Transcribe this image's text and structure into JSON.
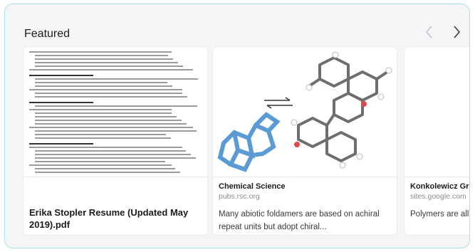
{
  "section": {
    "title": "Featured"
  },
  "nav": {
    "prev_icon": "chevron-left-icon",
    "next_icon": "chevron-right-icon"
  },
  "cards": [
    {
      "title": "Erika Stopler Resume (Updated May 2019).pdf"
    },
    {
      "title": "Chemical Science",
      "source": "pubs.rsc.org",
      "description": "Many abiotic foldamers are based on achiral repeat units but adopt chiral..."
    },
    {
      "title": "Konkolewicz Gro",
      "source": "sites.google.com",
      "description": "Polymers are all a the commodity p"
    }
  ],
  "colors": {
    "frame_border": "#a8e2e6",
    "molecule_blue": "#5b9bd5",
    "molecule_gray": "#6e6e6e"
  }
}
